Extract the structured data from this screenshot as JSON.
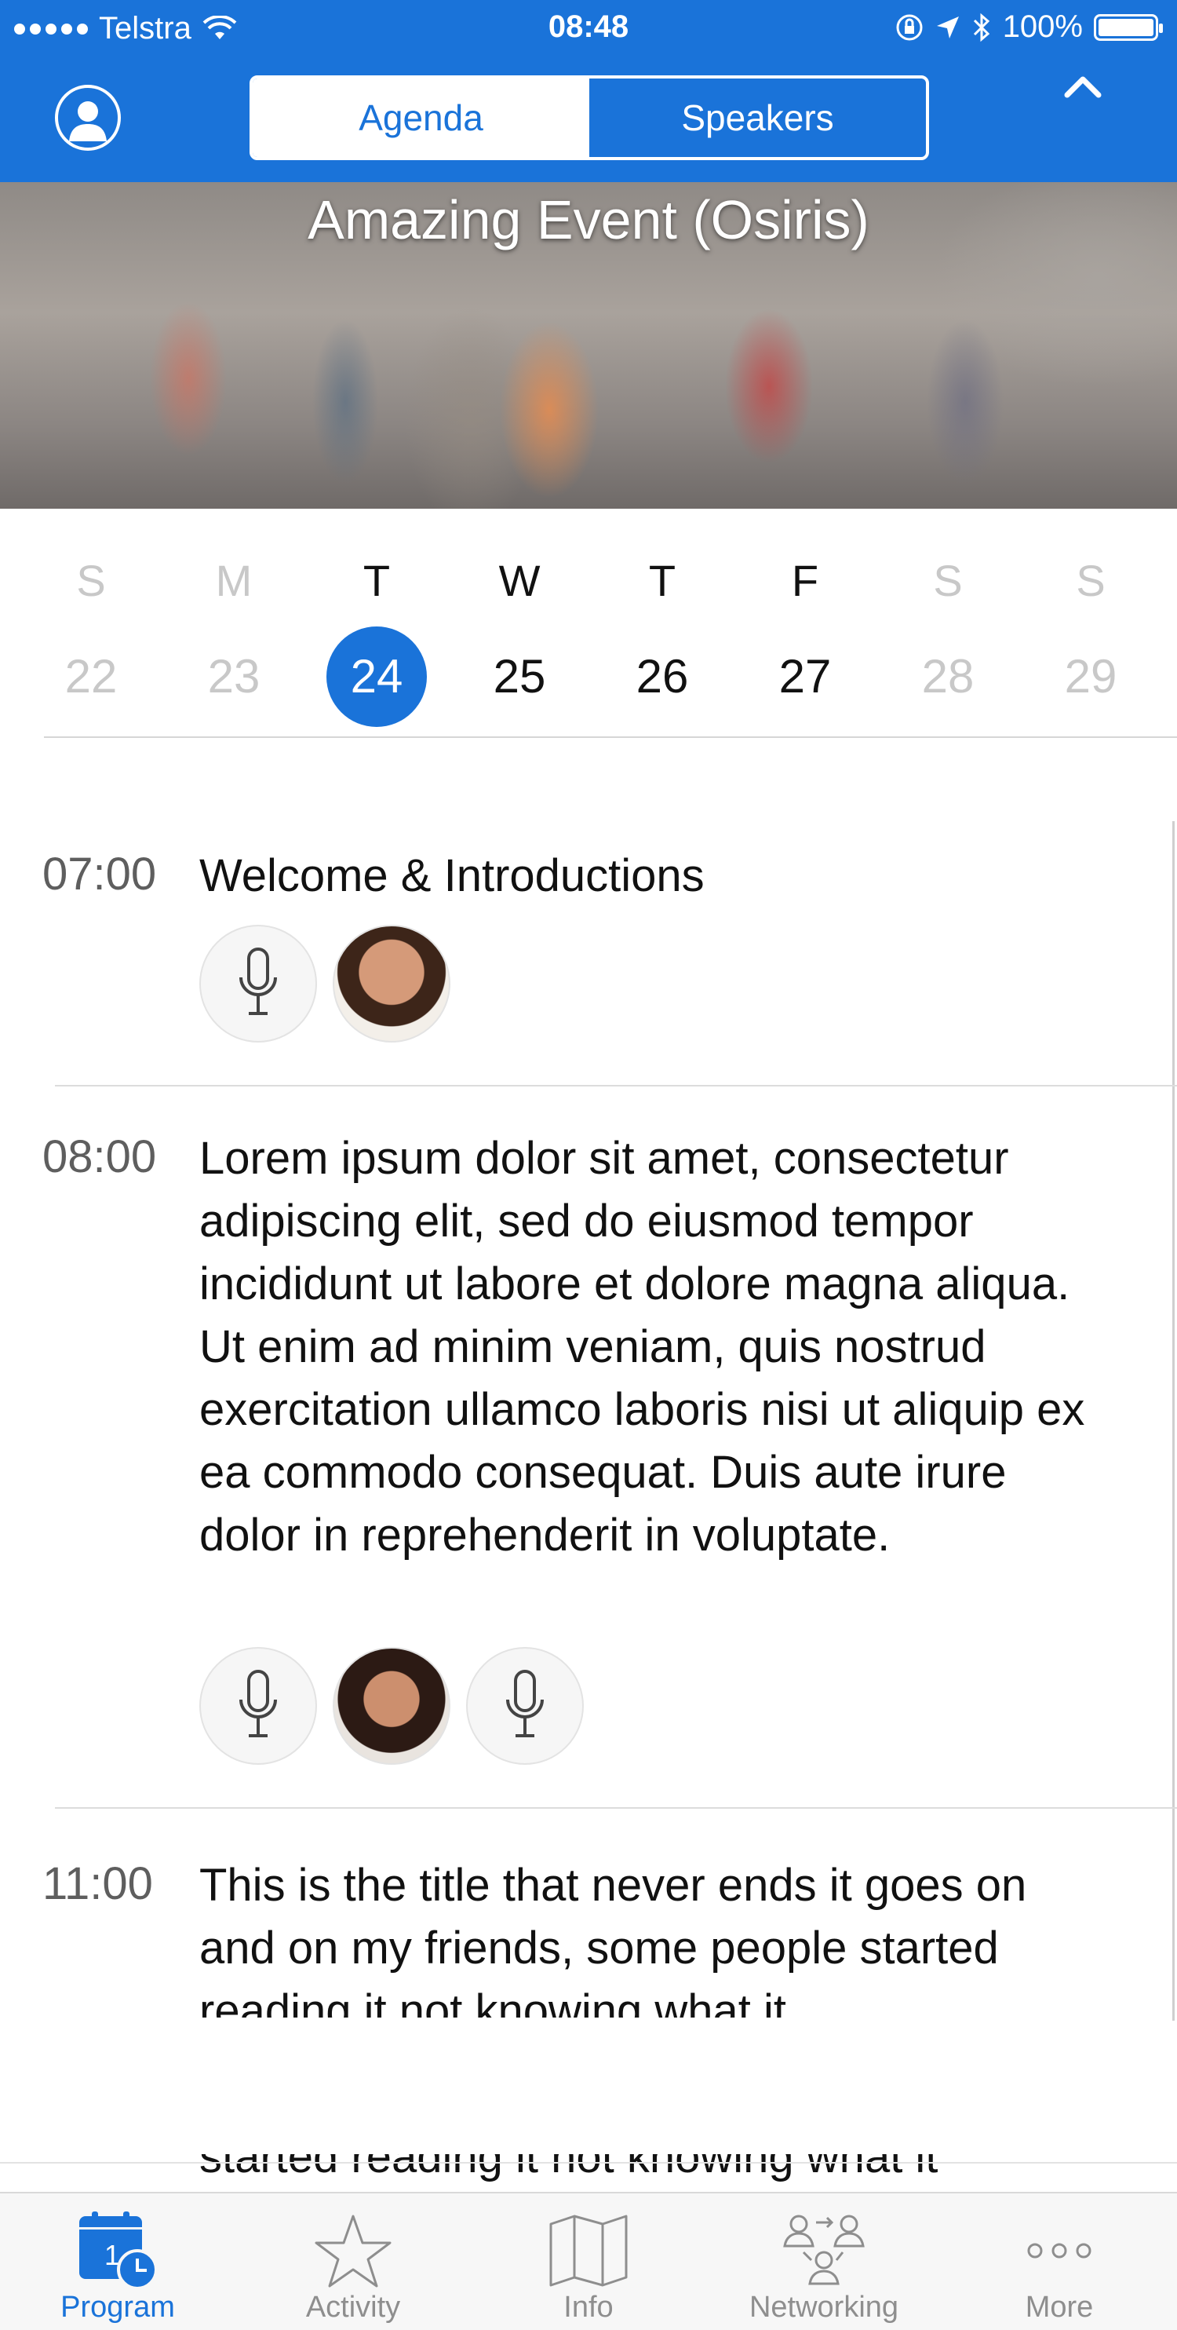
{
  "status_bar": {
    "carrier": "Telstra",
    "time": "08:48",
    "battery": "100%"
  },
  "header": {
    "tabs": [
      {
        "label": "Agenda",
        "active": true
      },
      {
        "label": "Speakers",
        "active": false
      }
    ],
    "accent_color": "#1a73d9"
  },
  "hero": {
    "title": "Amazing Event (Osiris)"
  },
  "week": {
    "days": [
      {
        "dow": "S",
        "num": "22",
        "state": "muted"
      },
      {
        "dow": "M",
        "num": "23",
        "state": "muted"
      },
      {
        "dow": "T",
        "num": "24",
        "state": "active"
      },
      {
        "dow": "W",
        "num": "25",
        "state": "normal"
      },
      {
        "dow": "T",
        "num": "26",
        "state": "normal"
      },
      {
        "dow": "F",
        "num": "27",
        "state": "normal"
      },
      {
        "dow": "S",
        "num": "28",
        "state": "muted"
      },
      {
        "dow": "S",
        "num": "29",
        "state": "muted"
      }
    ]
  },
  "sessions": [
    {
      "time": "07:00",
      "title": "Welcome & Introductions",
      "speakers": [
        "microphone-icon",
        "speaker-photo"
      ]
    },
    {
      "time": "08:00",
      "title": "Lorem ipsum dolor sit amet, consectetur adipiscing elit, sed do eiusmod tempor incididunt ut labore et dolore magna aliqua. Ut enim ad minim veniam, quis nostrud exercitation ullamco laboris nisi ut aliquip ex ea commodo consequat. Duis aute irure dolor in reprehenderit in voluptate.",
      "speakers": [
        "microphone-icon",
        "speaker-photo",
        "microphone-icon"
      ]
    },
    {
      "time": "11:00",
      "title": "This is the title that never ends it goes on and on my friends, some people started reading it not knowing what it"
    }
  ],
  "ghost_text": "started reading it not knowing what it",
  "tabbar": {
    "items": [
      {
        "label": "Program",
        "icon": "calendar-clock-icon",
        "active": true
      },
      {
        "label": "Activity",
        "icon": "star-icon",
        "active": false
      },
      {
        "label": "Info",
        "icon": "map-icon",
        "active": false
      },
      {
        "label": "Networking",
        "icon": "networking-icon",
        "active": false
      },
      {
        "label": "More",
        "icon": "more-dots-icon",
        "active": false
      }
    ],
    "calendar_badge": "1"
  }
}
